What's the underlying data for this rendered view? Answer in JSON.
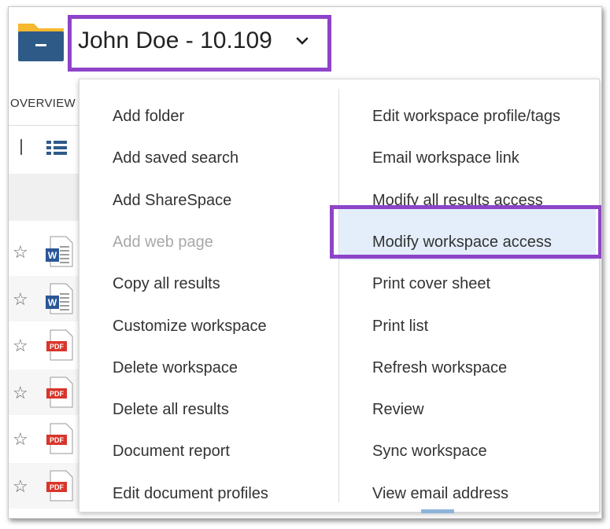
{
  "header": {
    "title": "John Doe - 10.109",
    "folder_icon": "folder-icon",
    "chevron_icon": "chevron-down-icon"
  },
  "tabs": {
    "overview_label": "OVERVIEW"
  },
  "toolbar": {
    "view_icon": "list-view-icon"
  },
  "rows": [
    {
      "type": "word"
    },
    {
      "type": "word"
    },
    {
      "type": "pdf"
    },
    {
      "type": "pdf"
    },
    {
      "type": "pdf"
    },
    {
      "type": "pdf"
    }
  ],
  "menu": {
    "left": [
      {
        "label": "Add folder",
        "disabled": false
      },
      {
        "label": "Add saved search",
        "disabled": false
      },
      {
        "label": "Add ShareSpace",
        "disabled": false
      },
      {
        "label": "Add web page",
        "disabled": true
      },
      {
        "label": "Copy all results",
        "disabled": false
      },
      {
        "label": "Customize workspace",
        "disabled": false
      },
      {
        "label": "Delete workspace",
        "disabled": false
      },
      {
        "label": "Delete all results",
        "disabled": false
      },
      {
        "label": "Document report",
        "disabled": false
      },
      {
        "label": "Edit document profiles",
        "disabled": false
      }
    ],
    "right": [
      {
        "label": "Edit workspace profile/tags"
      },
      {
        "label": "Email workspace link"
      },
      {
        "label": "Modify all results access"
      },
      {
        "label": "Modify workspace access",
        "highlighted": true
      },
      {
        "label": "Print cover sheet"
      },
      {
        "label": "Print list"
      },
      {
        "label": "Refresh workspace"
      },
      {
        "label": "Review"
      },
      {
        "label": "Sync workspace"
      },
      {
        "label": "View email address"
      }
    ]
  },
  "colors": {
    "highlight_border": "#8e44c9",
    "hover_bg": "#e3eefa",
    "folder_blue": "#2e5a87",
    "folder_yellow": "#f5b82e",
    "pdf_red": "#d9352a",
    "word_blue": "#2b5797"
  }
}
